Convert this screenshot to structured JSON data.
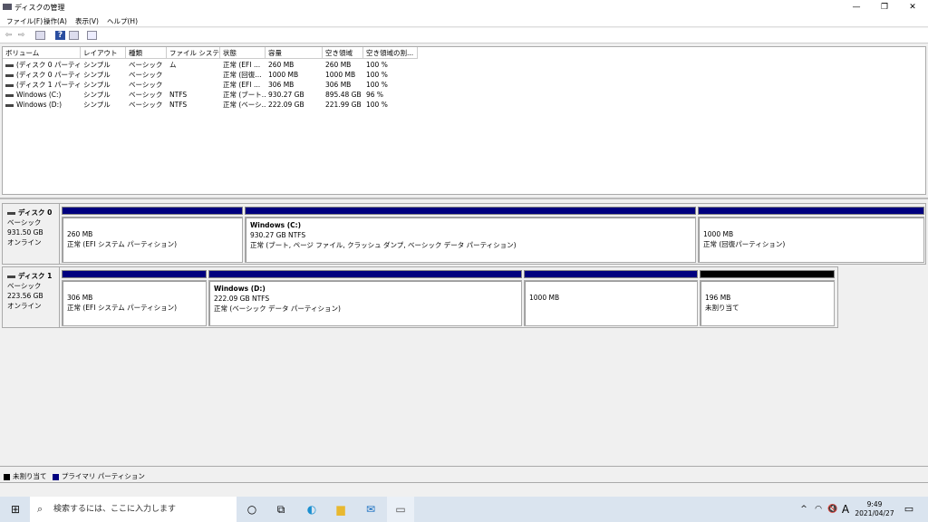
{
  "window": {
    "title": "ディスクの管理",
    "minimize": "—",
    "maximize": "❐",
    "close": "✕"
  },
  "menu": [
    "ファイル(F)",
    "操作(A)",
    "表示(V)",
    "ヘルプ(H)"
  ],
  "columns": [
    "ボリューム",
    "レイアウト",
    "種類",
    "ファイル システム",
    "状態",
    "容量",
    "空き領域",
    "空き領域の割..."
  ],
  "volumes": [
    [
      "(ディスク 0 パーティショ...",
      "シンプル",
      "ベーシック",
      "",
      "正常 (EFI ...",
      "260 MB",
      "260 MB",
      "100 %"
    ],
    [
      "(ディスク 0 パーティショ...",
      "シンプル",
      "ベーシック",
      "",
      "正常 (回復...",
      "1000 MB",
      "1000 MB",
      "100 %"
    ],
    [
      "(ディスク 1 パーティショ...",
      "シンプル",
      "ベーシック",
      "",
      "正常 (EFI ...",
      "306 MB",
      "306 MB",
      "100 %"
    ],
    [
      "Windows (C:)",
      "シンプル",
      "ベーシック",
      "NTFS",
      "正常 (ブート...",
      "930.27 GB",
      "895.48 GB",
      "96 %"
    ],
    [
      "Windows (D:)",
      "シンプル",
      "ベーシック",
      "NTFS",
      "正常 (ベーシ...",
      "222.09 GB",
      "221.99 GB",
      "100 %"
    ]
  ],
  "disks": [
    {
      "name": "ディスク 0",
      "type": "ベーシック",
      "size": "931.50 GB",
      "status": "オンライン",
      "partitions": [
        {
          "title": "",
          "size": "260 MB",
          "status": "正常 (EFI システム パーティション)"
        },
        {
          "title": "Windows  (C:)",
          "size": "930.27 GB NTFS",
          "status": "正常 (ブート, ページ ファイル, クラッシュ ダンプ, ベーシック データ パーティション)"
        },
        {
          "title": "",
          "size": "1000 MB",
          "status": "正常 (回復パーティション)"
        }
      ]
    },
    {
      "name": "ディスク 1",
      "type": "ベーシック",
      "size": "223.56 GB",
      "status": "オンライン",
      "partitions": [
        {
          "title": "",
          "size": "306 MB",
          "status": "正常 (EFI システム パーティション)"
        },
        {
          "title": "Windows  (D:)",
          "size": "222.09 GB NTFS",
          "status": "正常 (ベーシック データ パーティション)"
        },
        {
          "title": "",
          "size": "1000 MB",
          "status": ""
        },
        {
          "title": "",
          "size": "196 MB",
          "status": "未割り当て"
        }
      ]
    }
  ],
  "legend": {
    "unallocated": "未割り当て",
    "primary": "プライマリ パーティション"
  },
  "colors": {
    "primary": "#00007f",
    "unallocated": "#000000"
  },
  "taskbar": {
    "search_placeholder": "検索するには、ここに入力します",
    "ime": "A",
    "time": "9:49",
    "date": "2021/04/27"
  }
}
